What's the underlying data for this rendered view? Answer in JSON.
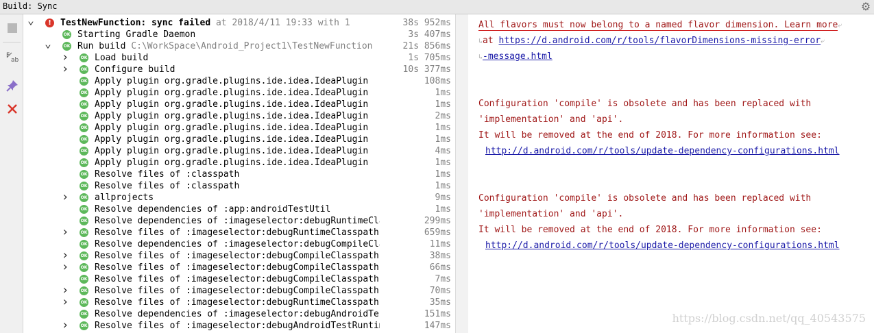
{
  "window": {
    "title": "Build: Sync"
  },
  "tree": {
    "rows": [
      {
        "indent": 0,
        "chevron": "down",
        "icon": "error",
        "bold": true,
        "label": "TestNewFunction: sync failed",
        "extra": "  at 2018/4/11 19:33   with 1",
        "time": "38s 952ms"
      },
      {
        "indent": 1,
        "chevron": "",
        "icon": "ok",
        "label": "Starting Gradle Daemon",
        "time": "3s 407ms"
      },
      {
        "indent": 1,
        "chevron": "down",
        "icon": "ok",
        "label": "Run build",
        "path": "C:\\WorkSpace\\Android_Project1\\TestNewFunction",
        "time": "21s 856ms"
      },
      {
        "indent": 2,
        "chevron": "right",
        "icon": "ok",
        "label": "Load build",
        "time": "1s 705ms"
      },
      {
        "indent": 2,
        "chevron": "right",
        "icon": "ok",
        "label": "Configure build",
        "time": "10s 377ms"
      },
      {
        "indent": 2,
        "chevron": "",
        "icon": "ok",
        "label": "Apply plugin org.gradle.plugins.ide.idea.IdeaPlugin",
        "time": "108ms"
      },
      {
        "indent": 2,
        "chevron": "",
        "icon": "ok",
        "label": "Apply plugin org.gradle.plugins.ide.idea.IdeaPlugin",
        "time": "1ms"
      },
      {
        "indent": 2,
        "chevron": "",
        "icon": "ok",
        "label": "Apply plugin org.gradle.plugins.ide.idea.IdeaPlugin",
        "time": "1ms"
      },
      {
        "indent": 2,
        "chevron": "",
        "icon": "ok",
        "label": "Apply plugin org.gradle.plugins.ide.idea.IdeaPlugin",
        "time": "2ms"
      },
      {
        "indent": 2,
        "chevron": "",
        "icon": "ok",
        "label": "Apply plugin org.gradle.plugins.ide.idea.IdeaPlugin",
        "time": "1ms"
      },
      {
        "indent": 2,
        "chevron": "",
        "icon": "ok",
        "label": "Apply plugin org.gradle.plugins.ide.idea.IdeaPlugin",
        "time": "1ms"
      },
      {
        "indent": 2,
        "chevron": "",
        "icon": "ok",
        "label": "Apply plugin org.gradle.plugins.ide.idea.IdeaPlugin",
        "time": "4ms"
      },
      {
        "indent": 2,
        "chevron": "",
        "icon": "ok",
        "label": "Apply plugin org.gradle.plugins.ide.idea.IdeaPlugin",
        "time": "1ms"
      },
      {
        "indent": 2,
        "chevron": "",
        "icon": "ok",
        "label": "Resolve files of :classpath",
        "time": "1ms"
      },
      {
        "indent": 2,
        "chevron": "",
        "icon": "ok",
        "label": "Resolve files of :classpath",
        "time": "1ms"
      },
      {
        "indent": 2,
        "chevron": "right",
        "icon": "ok",
        "label": "allprojects",
        "time": "9ms"
      },
      {
        "indent": 2,
        "chevron": "",
        "icon": "ok",
        "label": "Resolve dependencies of :app:androidTestUtil",
        "time": "1ms"
      },
      {
        "indent": 2,
        "chevron": "",
        "icon": "ok",
        "label": "Resolve dependencies of :imageselector:debugRuntimeCla",
        "time": "299ms"
      },
      {
        "indent": 2,
        "chevron": "right",
        "icon": "ok",
        "label": "Resolve files of :imageselector:debugRuntimeClasspath",
        "time": "659ms"
      },
      {
        "indent": 2,
        "chevron": "",
        "icon": "ok",
        "label": "Resolve dependencies of :imageselector:debugCompileCla",
        "time": "11ms"
      },
      {
        "indent": 2,
        "chevron": "right",
        "icon": "ok",
        "label": "Resolve files of :imageselector:debugCompileClasspath",
        "time": "38ms"
      },
      {
        "indent": 2,
        "chevron": "right",
        "icon": "ok",
        "label": "Resolve files of :imageselector:debugCompileClasspath",
        "time": "66ms"
      },
      {
        "indent": 2,
        "chevron": "",
        "icon": "ok",
        "label": "Resolve files of :imageselector:debugCompileClasspath",
        "time": "7ms"
      },
      {
        "indent": 2,
        "chevron": "right",
        "icon": "ok",
        "label": "Resolve files of :imageselector:debugCompileClasspath",
        "time": "70ms"
      },
      {
        "indent": 2,
        "chevron": "right",
        "icon": "ok",
        "label": "Resolve files of :imageselector:debugRuntimeClasspath",
        "time": "35ms"
      },
      {
        "indent": 2,
        "chevron": "",
        "icon": "ok",
        "label": "Resolve dependencies of :imageselector:debugAndroidTes",
        "time": "151ms"
      },
      {
        "indent": 2,
        "chevron": "right",
        "icon": "ok",
        "label": "Resolve files of :imageselector:debugAndroidTestRuntim",
        "time": "147ms"
      }
    ]
  },
  "console": {
    "msg1_line1": "All flavors must now belong to a named flavor dimension. Learn more",
    "msg1_at": "at ",
    "msg1_link1": "https://d.android.com/r/tools/flavorDimensions-missing-error",
    "msg1_link2": "-message.html",
    "msg2_line1": "Configuration 'compile' is obsolete and has been replaced with",
    "msg2_line2": " 'implementation' and 'api'.",
    "msg2_line3": "It will be removed at the end of 2018. For more information see:",
    "msg2_link": "http://d.android.com/r/tools/update-dependency-configurations.html",
    "msg3_line1": "Configuration 'compile' is obsolete and has been replaced with",
    "msg3_line2": " 'implementation' and 'api'.",
    "msg3_line3": "It will be removed at the end of 2018. For more information see:",
    "msg3_link": "http://d.android.com/r/tools/update-dependency-configurations.html"
  },
  "watermark": "https://blog.csdn.net/qq_40543575",
  "icons": {
    "toolbar": [
      "stop-icon",
      "soft-wrap-icon",
      "pin-icon",
      "close-icon"
    ],
    "settings": "gear-icon"
  },
  "colors": {
    "ok": "#5db85b",
    "error": "#d9352a",
    "console_text": "#a01818",
    "link": "#1a1aa8"
  }
}
